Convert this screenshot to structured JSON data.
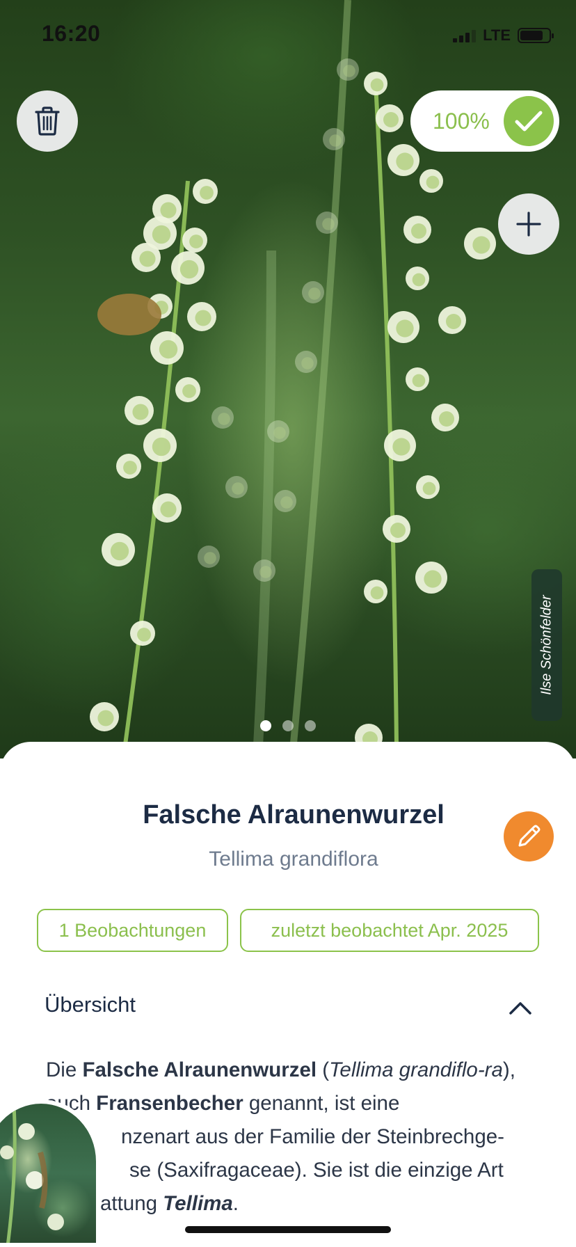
{
  "status_bar": {
    "time": "16:20",
    "network": "LTE"
  },
  "hero": {
    "confidence": "100%",
    "photo_credit": "Ilse Schönfelder",
    "page_count": 3,
    "active_page": 1,
    "actions": {
      "delete_icon": "trash-icon",
      "add_icon": "plus-icon",
      "confirm_icon": "check-icon"
    }
  },
  "species": {
    "common_name": "Falsche Alraunenwurzel",
    "scientific_name": "Tellima grandiflora",
    "edit_icon": "pencil-icon"
  },
  "chips": {
    "observations": "1 Beobachtungen",
    "last_observed": "zuletzt beobachtet Apr. 2025"
  },
  "overview": {
    "title": "Übersicht",
    "expanded": true,
    "description": [
      {
        "text": "Die ",
        "style": "normal"
      },
      {
        "text": "Falsche Alraunenwurzel",
        "style": "bold"
      },
      {
        "text": " (",
        "style": "normal"
      },
      {
        "text": "Tellima grandiflo-ra",
        "style": "italic"
      },
      {
        "text": "), auch ",
        "style": "normal"
      },
      {
        "text": "Fransenbecher",
        "style": "bold"
      },
      {
        "text": " genannt, ist eine ",
        "style": "normal"
      },
      {
        "text": "nzenart aus der Familie der Steinbrechge-",
        "style": "normal"
      },
      {
        "text": "se (Saxifragaceae). Sie ist die einzige Art ",
        "style": "normal"
      },
      {
        "text": "attung ",
        "style": "normal"
      },
      {
        "text": "Tellima",
        "style": "bold-italic"
      },
      {
        "text": ".",
        "style": "normal"
      }
    ]
  },
  "colors": {
    "accent_green": "#8bc34a",
    "edit_orange": "#f08a2e",
    "title_navy": "#1c2b44",
    "subtitle_gray": "#6e7b8e"
  }
}
